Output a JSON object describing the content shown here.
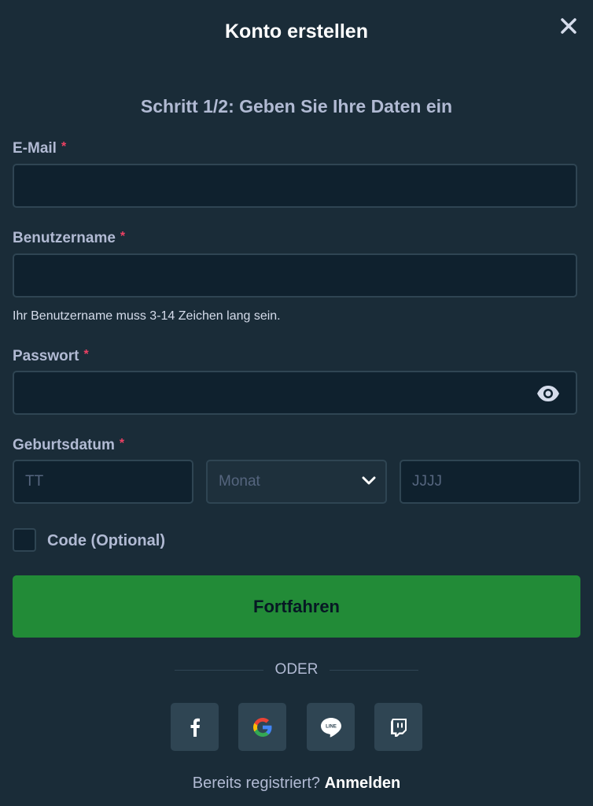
{
  "header": {
    "title": "Konto erstellen"
  },
  "step": {
    "text": "Schritt 1/2: Geben Sie Ihre Daten ein"
  },
  "fields": {
    "email": {
      "label": "E-Mail",
      "required": "*",
      "value": ""
    },
    "username": {
      "label": "Benutzername",
      "required": "*",
      "value": "",
      "hint": "Ihr Benutzername muss 3-14 Zeichen lang sein."
    },
    "password": {
      "label": "Passwort",
      "required": "*",
      "value": ""
    },
    "birthdate": {
      "label": "Geburtsdatum",
      "required": "*",
      "day_placeholder": "TT",
      "month_placeholder": "Monat",
      "year_placeholder": "JJJJ"
    }
  },
  "code": {
    "label": "Code (Optional)",
    "checked": false
  },
  "continue_button": {
    "label": "Fortfahren"
  },
  "divider": {
    "text": "ODER"
  },
  "social": [
    {
      "name": "facebook",
      "icon": "facebook-icon"
    },
    {
      "name": "google",
      "icon": "google-icon"
    },
    {
      "name": "line",
      "icon": "line-icon",
      "text": "LINE"
    },
    {
      "name": "twitch",
      "icon": "twitch-icon"
    }
  ],
  "footer": {
    "text": "Bereits registriert?",
    "link": "Anmelden"
  },
  "colors": {
    "background": "#1a2c38",
    "input_bg": "#0f212e",
    "border": "#2f4553",
    "accent_green": "#228b37",
    "required_red": "#ed4163",
    "label": "#b1bad3"
  }
}
